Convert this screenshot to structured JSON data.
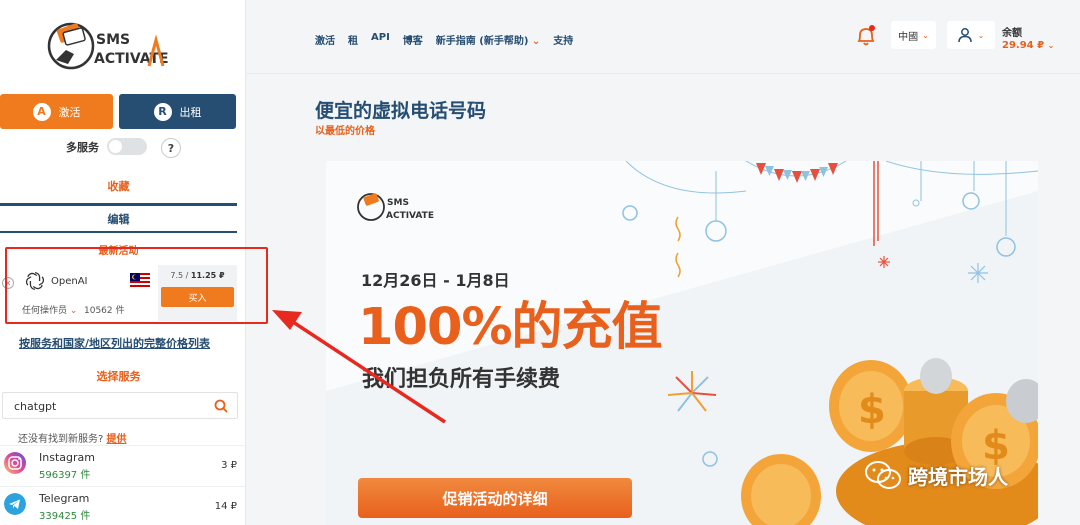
{
  "brand": {
    "logo_text_1": "SMS",
    "logo_text_2": "ACTIVATE"
  },
  "sidebar": {
    "activate_label": "激活",
    "rent_label": "出租",
    "multi_service_label": "多服务",
    "help_label": "?",
    "favorites_tab": "收藏",
    "edit_tab": "编辑",
    "latest_title": "最新活动",
    "offer": {
      "service": "OpenAI",
      "country_flag": "malaysia-flag",
      "operator_label": "任何操作员",
      "count": "10562 件",
      "price_old": "7.5 /",
      "price_new": "11.25 ₽",
      "buy_label": "买入"
    },
    "full_price_link": "按服务和国家/地区列出的完整价格列表",
    "choose_service_title": "选择服务",
    "search": {
      "value": "chatgpt"
    },
    "not_found_text": "还没有找到新服务?",
    "not_found_link": "提供",
    "services": [
      {
        "name": "Instagram",
        "count": "596397 件",
        "price": "3 ₽",
        "icon": "instagram-icon",
        "color": "#d6249f"
      },
      {
        "name": "Telegram",
        "count": "339425 件",
        "price": "14 ₽",
        "icon": "telegram-icon",
        "color": "#2aa3df"
      }
    ]
  },
  "header": {
    "nav": [
      "激活",
      "租",
      "API",
      "博客",
      "新手指南 (新手帮助)",
      "支持"
    ],
    "language": "中國",
    "balance_label": "余额",
    "balance_value": "29.94 ₽"
  },
  "main": {
    "title": "便宜的虚拟电话号码",
    "subtitle": "以最低的价格",
    "banner": {
      "date_range": "12月26日 - 1月8日",
      "headline": "100%的充值",
      "subline": "我们担负所有手续费",
      "cta": "促销活动的详细"
    }
  },
  "watermark": "跨境市场人",
  "colors": {
    "accent": "#e8601c",
    "navy": "#264d72",
    "success": "#2e8a3a",
    "annotation": "#e8291f"
  }
}
